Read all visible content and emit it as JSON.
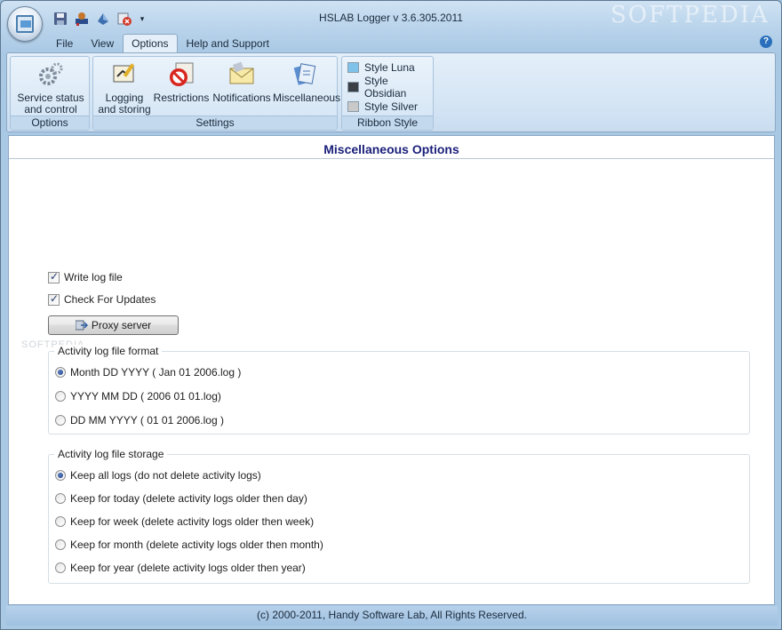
{
  "window": {
    "title": "HSLAB Logger v 3.6.305.2011",
    "watermark": "SOFTPEDIA"
  },
  "quick_access": {
    "icons": [
      "save-icon",
      "service-icon",
      "settings-icon",
      "stop-icon"
    ],
    "dropdown": "▾"
  },
  "tabs": [
    "File",
    "View",
    "Options",
    "Help and Support"
  ],
  "active_tab": "Options",
  "ribbon": {
    "groups": {
      "options": {
        "caption": "Options",
        "buttons": [
          {
            "line1": "Service status",
            "line2": "and control"
          }
        ]
      },
      "settings": {
        "caption": "Settings",
        "buttons": [
          {
            "line1": "Logging",
            "line2": "and storing"
          },
          {
            "line1": "Restrictions",
            "line2": ""
          },
          {
            "line1": "Notifications",
            "line2": ""
          },
          {
            "line1": "Miscellaneous",
            "line2": ""
          }
        ]
      },
      "ribbon_style": {
        "caption": "Ribbon Style",
        "items": [
          {
            "label": "Style Luna",
            "color": "#7fc3ea"
          },
          {
            "label": "Style Obsidian",
            "color": "#3a3f46"
          },
          {
            "label": "Style Silver",
            "color": "#c9c9c9"
          }
        ]
      }
    }
  },
  "content": {
    "title": "Miscellaneous Options",
    "checkboxes": [
      {
        "label": "Write log file",
        "checked": true
      },
      {
        "label": "Check For Updates",
        "checked": true
      }
    ],
    "proxy_button": "Proxy server",
    "watermark": "SOFTPEDIA",
    "log_format": {
      "legend": "Activity log file format",
      "options": [
        {
          "label": "Month DD YYYY ( Jan 01 2006.log )",
          "selected": true
        },
        {
          "label": "YYYY MM DD ( 2006 01 01.log)",
          "selected": false
        },
        {
          "label": "DD MM YYYY ( 01 01 2006.log )",
          "selected": false
        }
      ]
    },
    "log_storage": {
      "legend": "Activity log file storage",
      "options": [
        {
          "label": "Keep all logs (do not delete activity logs)",
          "selected": true
        },
        {
          "label": "Keep for today (delete activity logs older then day)",
          "selected": false
        },
        {
          "label": "Keep for week (delete activity logs older then week)",
          "selected": false
        },
        {
          "label": "Keep for month (delete activity logs older then month)",
          "selected": false
        },
        {
          "label": "Keep for year (delete activity logs older then year)",
          "selected": false
        }
      ]
    }
  },
  "status_bar": "(c) 2000-2011, Handy Software Lab, All Rights Reserved."
}
